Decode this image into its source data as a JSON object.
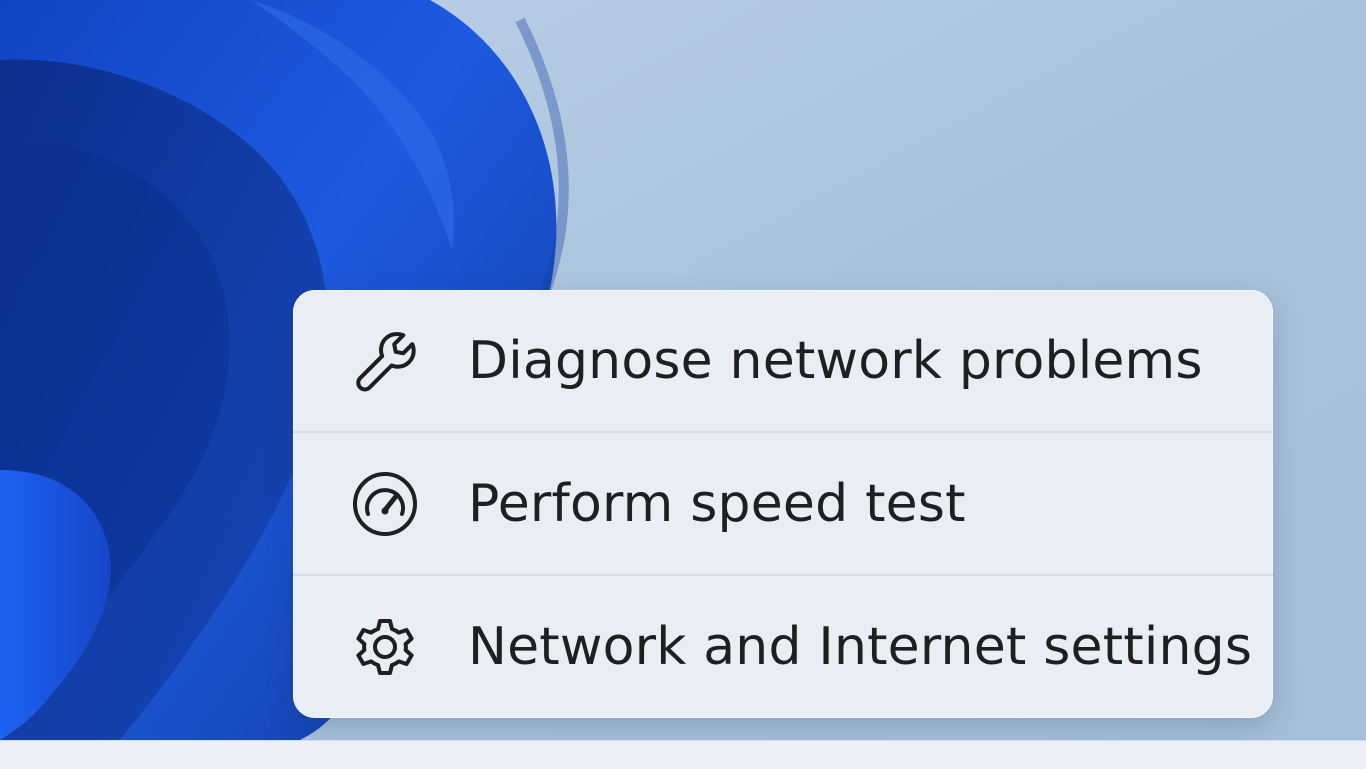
{
  "menu": {
    "items": [
      {
        "label": "Diagnose network problems",
        "icon": "wrench-icon"
      },
      {
        "label": "Perform speed test",
        "icon": "speedometer-icon"
      },
      {
        "label": "Network and Internet settings",
        "icon": "gear-icon"
      }
    ]
  },
  "colors": {
    "wallpaper_blue": "#1f56d2",
    "menu_background": "#e9edf4",
    "text": "#1f1f1f"
  }
}
